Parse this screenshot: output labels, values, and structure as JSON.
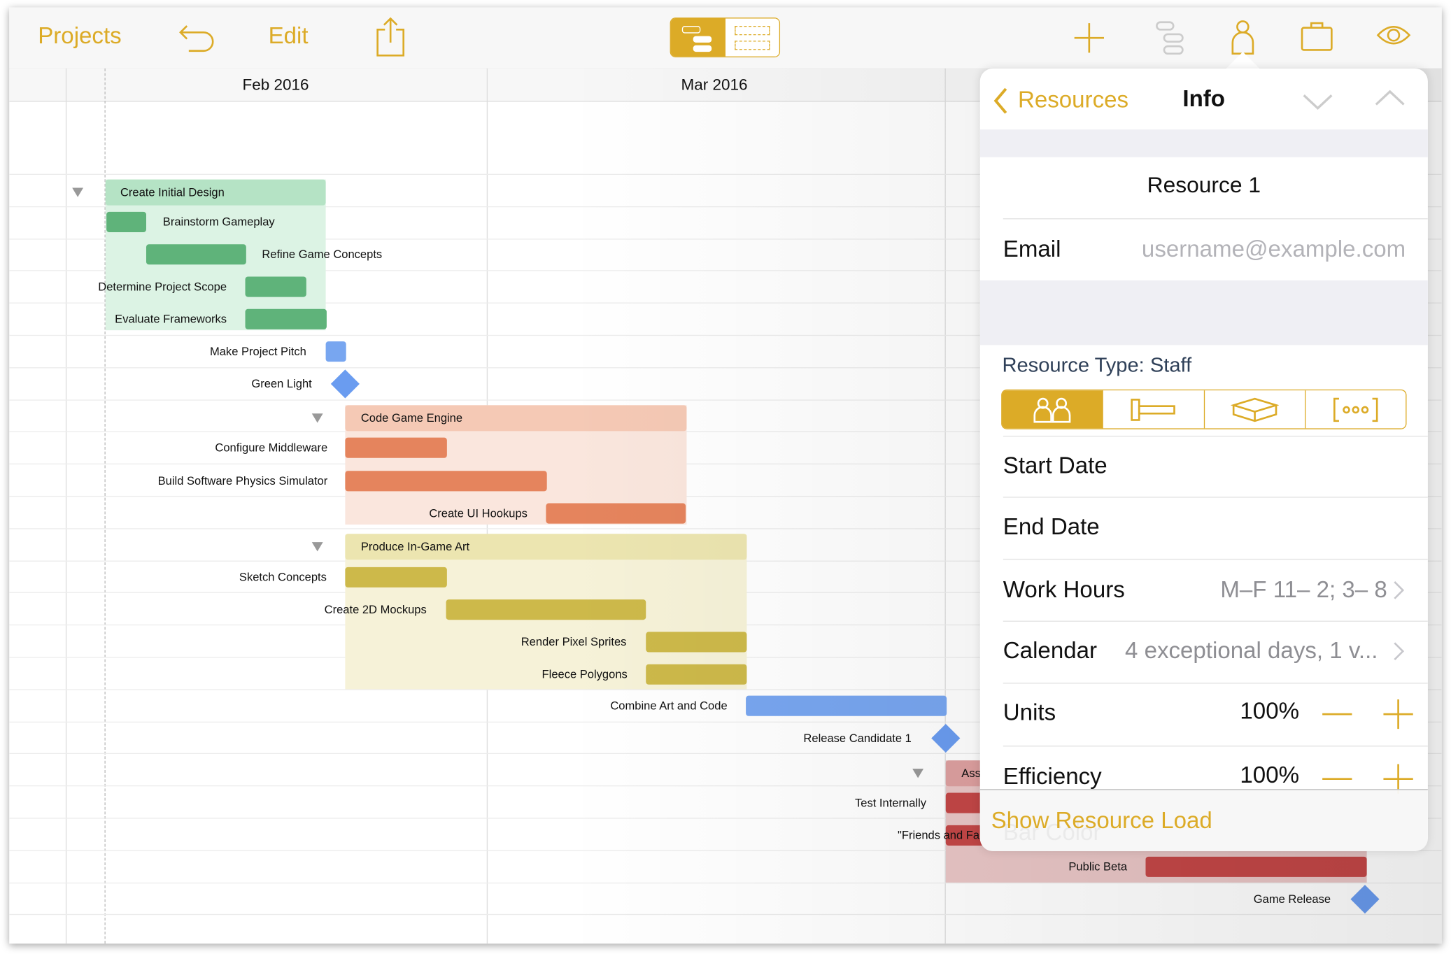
{
  "toolbar": {
    "projects_label": "Projects",
    "edit_label": "Edit",
    "icons": [
      "undo-icon",
      "share-icon",
      "view-mode-gantt-icon",
      "view-mode-network-icon",
      "add-icon",
      "outline-icon",
      "resource-icon",
      "briefcase-icon",
      "eye-icon"
    ],
    "accent": "#dcab27"
  },
  "timeline": {
    "months": [
      "Feb 2016",
      "Mar 2016"
    ]
  },
  "tasks": [
    {
      "name": "Create Initial Design",
      "kind": "group",
      "color": "#b5e3c5"
    },
    {
      "name": "Brainstorm Gameplay",
      "kind": "task",
      "color": "#5fb37a"
    },
    {
      "name": "Refine Game Concepts",
      "kind": "task",
      "color": "#5fb37a"
    },
    {
      "name": "Determine Project Scope",
      "kind": "task",
      "color": "#5fb37a"
    },
    {
      "name": "Evaluate Frameworks",
      "kind": "task",
      "color": "#5fb37a"
    },
    {
      "name": "Make Project Pitch",
      "kind": "task",
      "color": "#78a6f0"
    },
    {
      "name": "Green Light",
      "kind": "milestone",
      "color": "#6a9cf0"
    },
    {
      "name": "Code Game Engine",
      "kind": "group",
      "color": "#f5c9b5"
    },
    {
      "name": "Configure Middleware",
      "kind": "task",
      "color": "#e5845d"
    },
    {
      "name": "Build Software Physics Simulator",
      "kind": "task",
      "color": "#e5845d"
    },
    {
      "name": "Create UI Hookups",
      "kind": "task",
      "color": "#e5845d"
    },
    {
      "name": "Produce In-Game Art",
      "kind": "group",
      "color": "#ece5b0"
    },
    {
      "name": "Sketch Concepts",
      "kind": "task",
      "color": "#cdb94a"
    },
    {
      "name": "Create 2D Mockups",
      "kind": "task",
      "color": "#cdb94a"
    },
    {
      "name": "Render Pixel Sprites",
      "kind": "task",
      "color": "#cdb94a"
    },
    {
      "name": "Fleece Polygons",
      "kind": "task",
      "color": "#cdb94a"
    },
    {
      "name": "Combine Art and Code",
      "kind": "task",
      "color": "#78a6f0"
    },
    {
      "name": "Release Candidate 1",
      "kind": "milestone",
      "color": "#6a9cf0"
    },
    {
      "name": "Ass",
      "kind": "group",
      "color": "#dea0a0"
    },
    {
      "name": "Test Internally",
      "kind": "task",
      "color": "#c44747"
    },
    {
      "name": "\"Friends and Far",
      "kind": "task",
      "color": "#c44747"
    },
    {
      "name": "Public Beta",
      "kind": "task",
      "color": "#c44747"
    },
    {
      "name": "Game Release",
      "kind": "milestone",
      "color": "#6a9cf0"
    }
  ],
  "panel": {
    "back_label": "Resources",
    "title": "Info",
    "resource_name": "Resource 1",
    "email_label": "Email",
    "email_placeholder": "username@example.com",
    "resource_type": "Resource Type: Staff",
    "type_options": [
      "staff",
      "equipment",
      "material",
      "group"
    ],
    "selected_type": "staff",
    "start_date_label": "Start Date",
    "end_date_label": "End Date",
    "work_hours_label": "Work Hours",
    "work_hours_value": "M–F 11– 2; 3– 8",
    "calendar_label": "Calendar",
    "calendar_value": "4 exceptional days, 1 v...",
    "units_label": "Units",
    "units_value": "100%",
    "efficiency_label": "Efficiency",
    "efficiency_value": "100%",
    "show_load_label": "Show Resource Load",
    "bar_color_label": "Bar Color"
  }
}
